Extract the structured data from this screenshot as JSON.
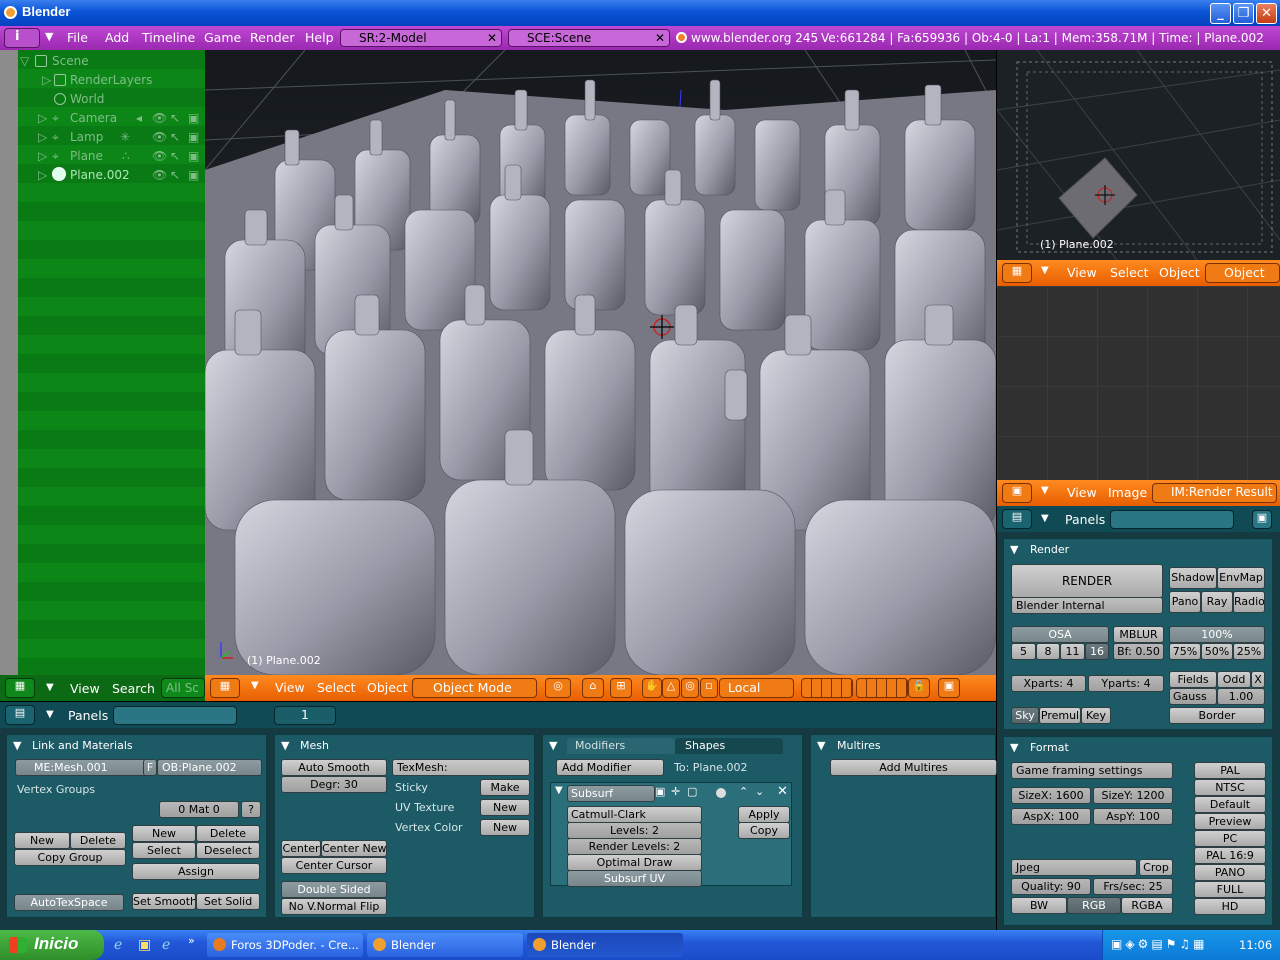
{
  "window": {
    "title": "Blender"
  },
  "infobar": {
    "menus": [
      "File",
      "Add",
      "Timeline",
      "Game",
      "Render",
      "Help"
    ],
    "screen": "SR:2-Model",
    "scene": "SCE:Scene",
    "url": "www.blender.org 245",
    "stats": "Ve:661284 | Fa:659936 | Ob:4-0 | La:1  | Mem:358.71M  | Time: | Plane.002"
  },
  "outliner": {
    "items": [
      "Scene",
      "RenderLayers",
      "World",
      "Camera",
      "Lamp",
      "Plane",
      "Plane.002"
    ],
    "header_menus": [
      "View",
      "Search"
    ],
    "filter": "All Sc"
  },
  "viewport": {
    "object_label": "(1) Plane.002",
    "menus": [
      "View",
      "Select",
      "Object"
    ],
    "mode": "Object Mode",
    "orientation": "Local"
  },
  "camera_view": {
    "object_label": "(1) Plane.002",
    "menus": [
      "View",
      "Select",
      "Object"
    ],
    "mode": "Object M"
  },
  "image_editor": {
    "menus": [
      "View",
      "Image"
    ],
    "image": "IM:Render Result"
  },
  "buttons": {
    "header_label": "Panels",
    "frame": "1",
    "link_materials": {
      "title": "Link and Materials",
      "mesh": "ME:Mesh.001",
      "f_label": "F",
      "object": "OB:Plane.002",
      "vertex_groups": "Vertex Groups",
      "mat": "0 Mat 0",
      "question": "?",
      "new": "New",
      "delete": "Delete",
      "copy_group": "Copy Group",
      "new2": "New",
      "delete2": "Delete",
      "select": "Select",
      "deselect": "Deselect",
      "assign": "Assign",
      "autotexspace": "AutoTexSpace",
      "set_smooth": "Set Smooth",
      "set_solid": "Set Solid"
    },
    "mesh": {
      "title": "Mesh",
      "auto_smooth": "Auto Smooth",
      "degr": "Degr: 30",
      "texmesh": "TexMesh:",
      "sticky": "Sticky",
      "make": "Make",
      "uv_texture": "UV Texture",
      "new_uv": "New",
      "vertex_color": "Vertex Color",
      "new_vc": "New",
      "center": "Center",
      "center_new": "Center New",
      "center_cursor": "Center Cursor",
      "double_sided": "Double Sided",
      "no_vnormal_flip": "No V.Normal Flip"
    },
    "modifiers": {
      "tab_modifiers": "Modifiers",
      "tab_shapes": "Shapes",
      "add_modifier": "Add Modifier",
      "to": "To: Plane.002",
      "name": "Subsurf",
      "type": "Catmull-Clark",
      "levels": "Levels: 2",
      "render_levels": "Render Levels: 2",
      "optimal_draw": "Optimal Draw",
      "subsurf_uv": "Subsurf UV",
      "apply": "Apply",
      "copy": "Copy"
    },
    "multires": {
      "title": "Multires",
      "add": "Add Multires"
    }
  },
  "render": {
    "title": "Render",
    "render_btn": "RENDER",
    "engine": "Blender Internal",
    "shadow": "Shadow",
    "envmap": "EnvMap",
    "pano": "Pano",
    "ray": "Ray",
    "radio": "Radio",
    "osa": "OSA",
    "osa_vals": [
      "5",
      "8",
      "11",
      "16"
    ],
    "mblur": "MBLUR",
    "bf": "Bf: 0.50",
    "pct": [
      "100%",
      "75%",
      "50%",
      "25%"
    ],
    "xparts": "Xparts: 4",
    "yparts": "Yparts: 4",
    "fields": "Fields",
    "odd": "Odd",
    "x": "X",
    "gauss": "Gauss",
    "gauss_val": "1.00",
    "sky": "Sky",
    "premul": "Premul",
    "key": "Key",
    "border": "Border"
  },
  "format": {
    "title": "Format",
    "preset": "Game framing settings",
    "sizex": "SizeX: 1600",
    "sizey": "SizeY: 1200",
    "aspx": "AspX: 100",
    "aspy": "AspY: 100",
    "filetype": "Jpeg",
    "crop": "Crop",
    "quality": "Quality: 90",
    "fps": "Frs/sec: 25",
    "bw": "BW",
    "rgb": "RGB",
    "rgba": "RGBA",
    "presets": [
      "PAL",
      "NTSC",
      "Default",
      "Preview",
      "PC",
      "PAL 16:9",
      "PANO",
      "FULL",
      "HD"
    ]
  },
  "taskbar": {
    "start": "Inicio",
    "tasks": [
      "Foros 3DPoder. - Cre...",
      "Blender",
      "Blender"
    ],
    "clock": "11:06"
  },
  "colors": {
    "info_bar": "#b03cc8",
    "outliner": "#0a7a14",
    "header": "#f07a14",
    "panels": "#1c5a66"
  }
}
